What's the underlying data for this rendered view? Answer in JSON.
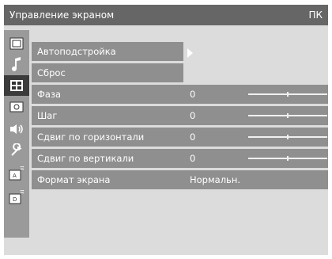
{
  "header": {
    "title": "Управление экраном",
    "mode": "ПК"
  },
  "sidebar": {
    "icons": [
      "picture-icon",
      "sound-icon",
      "screen-icon",
      "setup-icon",
      "speaker-icon",
      "wrench-icon",
      "antenna-a-icon",
      "antenna-b-icon"
    ],
    "selected": "screen-icon"
  },
  "submenu": [
    {
      "label": "Автоподстройка"
    },
    {
      "label": "Сброс"
    }
  ],
  "settings": [
    {
      "label": "Фаза",
      "value": "0",
      "slider_level": 0.5
    },
    {
      "label": "Шаг",
      "value": "0",
      "slider_level": 0.5
    },
    {
      "label": "Сдвиг по горизонтали",
      "value": "0",
      "slider_level": 0.5
    },
    {
      "label": "Сдвиг по вертикали",
      "value": "0",
      "slider_level": 0.5
    },
    {
      "label": "Формат экрана",
      "value": "Нормальн."
    }
  ]
}
